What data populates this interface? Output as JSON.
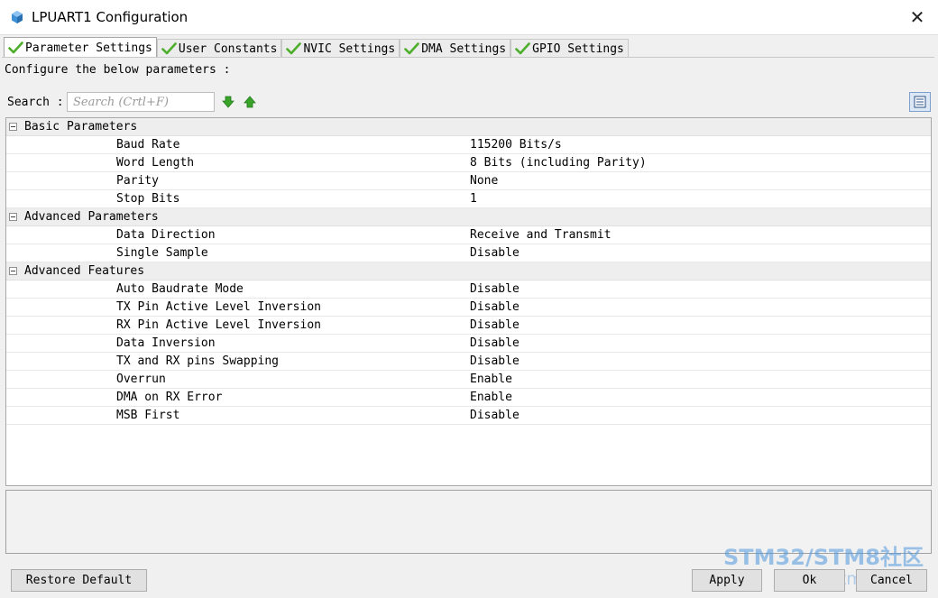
{
  "window": {
    "title": "LPUART1 Configuration",
    "close_symbol": "✕"
  },
  "tabs": [
    {
      "label": "Parameter Settings",
      "icon": "check-icon",
      "active": true
    },
    {
      "label": "User Constants",
      "icon": "check-icon",
      "active": false
    },
    {
      "label": "NVIC Settings",
      "icon": "check-icon",
      "active": false
    },
    {
      "label": "DMA Settings",
      "icon": "check-icon",
      "active": false
    },
    {
      "label": "GPIO Settings",
      "icon": "check-icon",
      "active": false
    }
  ],
  "panel": {
    "description": "Configure the below parameters :",
    "search_label": "Search :",
    "search_placeholder": "Search (Crtl+F)"
  },
  "groups": [
    {
      "title": "Basic Parameters",
      "params": [
        {
          "name": "Baud Rate",
          "value": "115200 Bits/s"
        },
        {
          "name": "Word Length",
          "value": "8 Bits (including Parity)"
        },
        {
          "name": "Parity",
          "value": "None"
        },
        {
          "name": "Stop Bits",
          "value": "1"
        }
      ]
    },
    {
      "title": "Advanced Parameters",
      "params": [
        {
          "name": "Data Direction",
          "value": "Receive and Transmit"
        },
        {
          "name": "Single Sample",
          "value": "Disable"
        }
      ]
    },
    {
      "title": "Advanced Features",
      "params": [
        {
          "name": "Auto Baudrate Mode",
          "value": "Disable"
        },
        {
          "name": "TX Pin Active Level Inversion",
          "value": "Disable"
        },
        {
          "name": "RX Pin Active Level Inversion",
          "value": "Disable"
        },
        {
          "name": "Data Inversion",
          "value": "Disable"
        },
        {
          "name": "TX and RX pins Swapping",
          "value": "Disable"
        },
        {
          "name": "Overrun",
          "value": "Enable"
        },
        {
          "name": "DMA on RX Error",
          "value": "Enable"
        },
        {
          "name": "MSB First",
          "value": "Disable"
        }
      ]
    }
  ],
  "buttons": {
    "restore_default": "Restore Default",
    "apply": "Apply",
    "ok": "Ok",
    "cancel": "Cancel"
  },
  "watermark": {
    "line1": "STM32/STM8社区",
    "line2": "www.stmcu.org"
  },
  "colors": {
    "check_green": "#4cae2a",
    "arrow_green": "#3aa32a",
    "app_icon_blue": "#3d8fd6",
    "watermark_blue": "#4f97dd"
  }
}
